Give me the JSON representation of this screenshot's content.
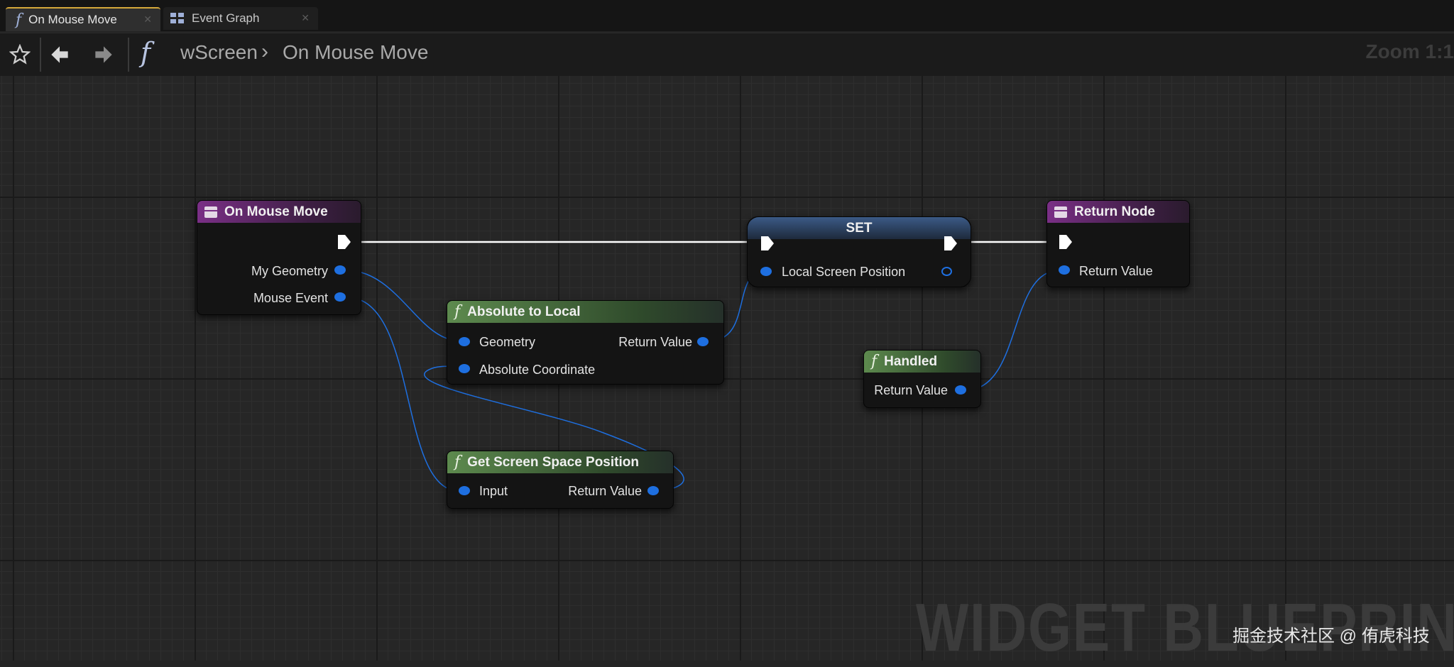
{
  "tabs": [
    {
      "label": "On Mouse Move",
      "icon": "function-icon",
      "active": true
    },
    {
      "label": "Event Graph",
      "icon": "graph-icon",
      "active": false
    }
  ],
  "toolbar": {
    "breadcrumb": [
      "wScreen",
      "On Mouse Move"
    ],
    "zoom": "Zoom 1:1"
  },
  "nodes": {
    "on_mouse_move": {
      "title": "On Mouse Move",
      "pins": [
        "My Geometry",
        "Mouse Event"
      ]
    },
    "absolute_to_local": {
      "title": "Absolute to Local",
      "pins": [
        "Geometry",
        "Absolute Coordinate",
        "Return Value"
      ]
    },
    "set": {
      "title": "SET",
      "pins": [
        "Local Screen Position"
      ]
    },
    "return_node": {
      "title": "Return Node",
      "pins": [
        "Return Value"
      ]
    },
    "handled": {
      "title": "Handled",
      "pins": [
        "Return Value"
      ]
    },
    "get_screen_space_position": {
      "title": "Get Screen Space Position",
      "pins": [
        "Input",
        "Return Value"
      ]
    }
  },
  "watermark": "WIDGET BLUEPRINT",
  "credit": "掘金技术社区 @ 侑虎科技",
  "colors": {
    "event_header": "#7a2f86",
    "function_header": "#5d8a4e",
    "set_header": "#3b5a86",
    "pin": "#1e6fe0",
    "wire_exec": "#ffffff",
    "wire_data": "#1e6fe0",
    "active_tab": "#d6a93a"
  }
}
